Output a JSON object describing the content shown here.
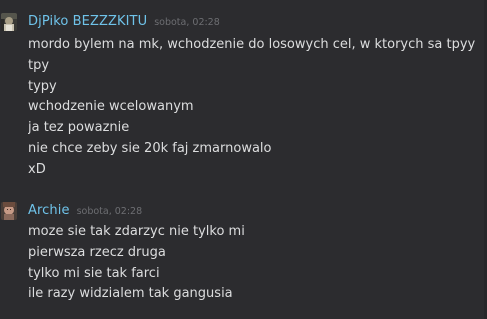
{
  "messages": [
    {
      "username": "DjPiko BEZZZKITU",
      "timestamp": "sobota, 02:28",
      "lines": [
        "mordo bylem na mk, wchodzenie do losowych cel, w ktorych sa tpyy",
        "tpy",
        "typy",
        "wchodzenie wcelowanym",
        "ja tez powaznie",
        "nie chce zeby sie 20k faj zmarnowalo",
        "xD"
      ]
    },
    {
      "username": "Archie",
      "timestamp": "sobota, 02:28",
      "lines": [
        "moze sie tak zdarzyc nie tylko mi",
        "pierwsza rzecz druga",
        "tylko mi sie tak farci",
        "ile razy widzialem tak gangusia"
      ]
    }
  ],
  "colors": {
    "background": "#2c2c2f",
    "username": "#6fc3ea",
    "timestamp": "#6d6e72",
    "text": "#dcddde"
  },
  "icons": {
    "avatar_1": "user-avatar",
    "avatar_2": "user-avatar"
  }
}
